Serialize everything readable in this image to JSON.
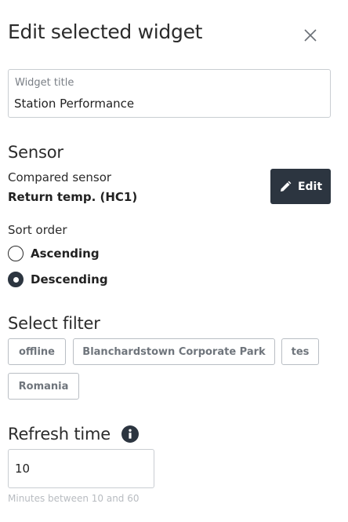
{
  "header": {
    "title": "Edit selected widget",
    "close_icon": "close-icon"
  },
  "widget_title": {
    "label": "Widget title",
    "value": "Station Performance"
  },
  "sensor": {
    "heading": "Sensor",
    "compared_label": "Compared sensor",
    "compared_value": "Return temp. (HC1)",
    "edit_label": "Edit",
    "edit_icon": "pencil-icon"
  },
  "sort_order": {
    "label": "Sort order",
    "options": [
      {
        "label": "Ascending",
        "selected": false
      },
      {
        "label": "Descending",
        "selected": true
      }
    ]
  },
  "filter": {
    "heading": "Select filter",
    "chips": [
      "offline",
      "Blanchardstown Corporate Park",
      "tes",
      "Romania"
    ]
  },
  "refresh": {
    "heading": "Refresh time",
    "info_icon": "info-icon",
    "value": "10",
    "hint": "Minutes between 10 and 60"
  },
  "colors": {
    "accent_dark": "#2c3540",
    "border": "#c9cdd2",
    "chip_text": "#6f757c",
    "hint_text": "#b8bcc1"
  }
}
